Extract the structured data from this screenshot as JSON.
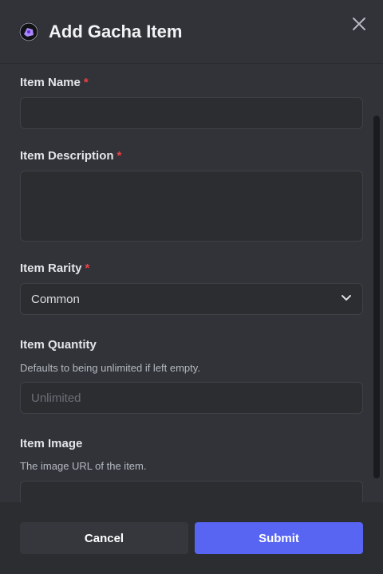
{
  "modal": {
    "title": "Add Gacha Item",
    "close_icon": "close-icon",
    "app_icon": "gacha-logo-icon"
  },
  "fields": {
    "item_name": {
      "label": "Item Name",
      "required_mark": "*",
      "value": ""
    },
    "item_description": {
      "label": "Item Description",
      "required_mark": "*",
      "value": ""
    },
    "item_rarity": {
      "label": "Item Rarity",
      "required_mark": "*",
      "selected": "Common"
    },
    "item_quantity": {
      "label": "Item Quantity",
      "hint": "Defaults to being unlimited if left empty.",
      "placeholder": "Unlimited",
      "value": ""
    },
    "item_image": {
      "label": "Item Image",
      "hint": "The image URL of the item.",
      "value": ""
    }
  },
  "footer": {
    "cancel_label": "Cancel",
    "submit_label": "Submit"
  },
  "colors": {
    "background": "#313338",
    "footer": "#2b2d31",
    "accent": "#5865f2",
    "required": "#f23f43"
  }
}
